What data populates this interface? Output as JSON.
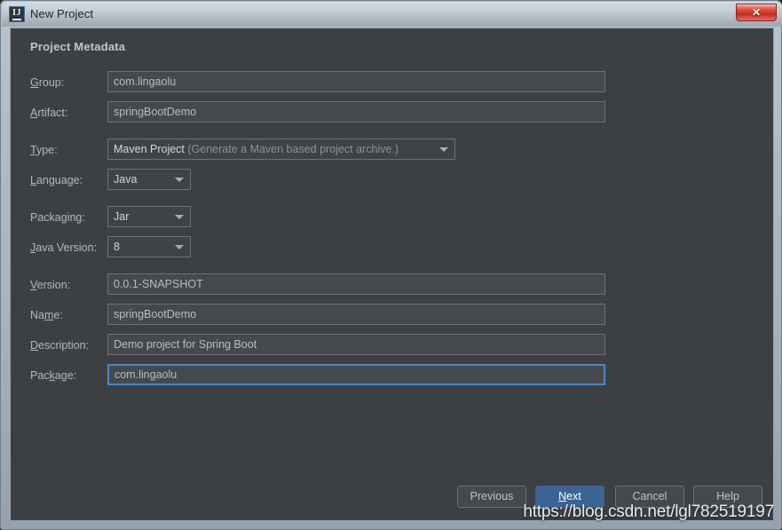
{
  "window": {
    "title": "New Project",
    "app_icon": "intellij-ij-icon",
    "close_label": "✕"
  },
  "dialog": {
    "section_title": "Project Metadata",
    "fields": [
      {
        "id": "group",
        "label": "Group:",
        "mnemonic": "G",
        "value": "com.lingaolu",
        "kind": "text",
        "focused": false
      },
      {
        "id": "artifact",
        "label": "Artifact:",
        "mnemonic": "A",
        "value": "springBootDemo",
        "kind": "text",
        "focused": false
      },
      {
        "id": "type",
        "label": "Type:",
        "mnemonic": "T",
        "value": "Maven Project",
        "hint": "(Generate a Maven based project archive.)",
        "kind": "combo"
      },
      {
        "id": "language",
        "label": "Language:",
        "mnemonic": "L",
        "value": "Java",
        "kind": "combo"
      },
      {
        "id": "packaging",
        "label": "Packaging:",
        "mnemonic": "g",
        "value": "Jar",
        "kind": "combo"
      },
      {
        "id": "java-version",
        "label": "Java Version:",
        "mnemonic": "J",
        "value": "8",
        "kind": "combo"
      },
      {
        "id": "version",
        "label": "Version:",
        "mnemonic": "V",
        "value": "0.0.1-SNAPSHOT",
        "kind": "text",
        "focused": false
      },
      {
        "id": "name",
        "label": "Name:",
        "mnemonic": "m",
        "value": "springBootDemo",
        "kind": "text",
        "focused": false
      },
      {
        "id": "description",
        "label": "Description:",
        "mnemonic": "D",
        "value": "Demo project for Spring Boot",
        "kind": "text",
        "focused": false
      },
      {
        "id": "package",
        "label": "Package:",
        "mnemonic": "k",
        "value": "com.lingaolu",
        "kind": "text",
        "focused": true
      }
    ],
    "labels": {
      "group": "Group:",
      "artifact": "Artifact:",
      "type": "Type:",
      "language": "Language:",
      "packaging": "Packaging:",
      "java_version": "Java Version:",
      "version": "Version:",
      "name": "Name:",
      "description": "Description:",
      "package": "Package:"
    },
    "values": {
      "group": "com.lingaolu",
      "artifact": "springBootDemo",
      "type": "Maven Project",
      "type_hint": "(Generate a Maven based project archive.)",
      "language": "Java",
      "packaging": "Jar",
      "java_version": "8",
      "version": "0.0.1-SNAPSHOT",
      "name": "springBootDemo",
      "description": "Demo project for Spring Boot",
      "package": "com.lingaolu"
    }
  },
  "buttons": {
    "previous": "Previous",
    "next": "Next",
    "next_mnemonic": "N",
    "cancel": "Cancel",
    "help": "Help"
  },
  "watermark": "https://blog.csdn.net/lgl782519197",
  "colors": {
    "panel_bg": "#3c4043",
    "field_bg": "#45494c",
    "field_border": "#6d7275",
    "focus_border": "#4a88c7",
    "primary_button": "#3b6394",
    "text": "#b4b8bb",
    "title_bar": "#c3cbd3",
    "close_button": "#c32c21"
  }
}
